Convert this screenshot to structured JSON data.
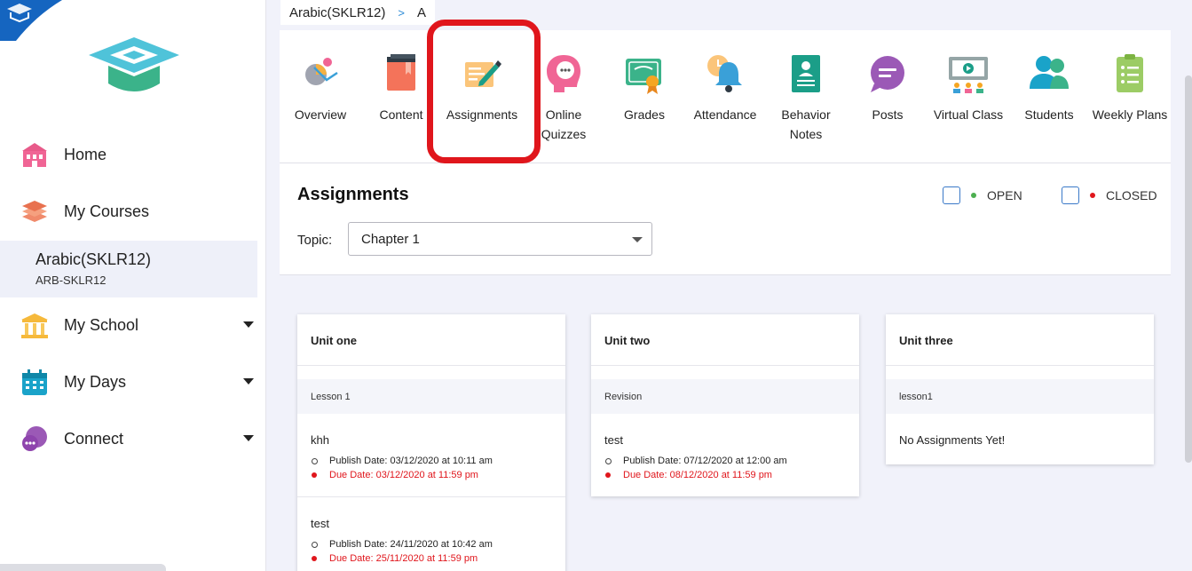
{
  "breadcrumb": {
    "course": "Arabic(SKLR12)",
    "separator": ">",
    "current": "A"
  },
  "sidebar": {
    "items": [
      {
        "label": "Home"
      },
      {
        "label": "My Courses"
      },
      {
        "label": "My School"
      },
      {
        "label": "My Days"
      },
      {
        "label": "Connect"
      }
    ],
    "selected_course": {
      "name": "Arabic(SKLR12)",
      "code": "ARB-SKLR12"
    }
  },
  "tabs": [
    {
      "label": "Overview",
      "icon": "overview-icon"
    },
    {
      "label": "Content",
      "icon": "book-icon"
    },
    {
      "label": "Assignments",
      "icon": "assignment-pen-icon"
    },
    {
      "label": "Online Quizzes",
      "icon": "quiz-head-icon"
    },
    {
      "label": "Grades",
      "icon": "certificate-icon"
    },
    {
      "label": "Attendance",
      "icon": "bell-clock-icon"
    },
    {
      "label": "Behavior Notes",
      "icon": "badge-icon"
    },
    {
      "label": "Posts",
      "icon": "chat-bubble-icon"
    },
    {
      "label": "Virtual Class",
      "icon": "virtual-class-icon"
    },
    {
      "label": "Students",
      "icon": "students-icon"
    },
    {
      "label": "Weekly Plans",
      "icon": "clipboard-icon"
    }
  ],
  "assignments": {
    "title": "Assignments",
    "legend_open": "OPEN",
    "legend_closed": "CLOSED",
    "topic_label": "Topic:",
    "topic_value": "Chapter 1"
  },
  "units": [
    {
      "name": "Unit one",
      "lesson": "Lesson 1",
      "items": [
        {
          "name": "khh",
          "publish": "Publish Date: 03/12/2020 at 10:11 am",
          "due": "Due Date: 03/12/2020 at 11:59 pm"
        },
        {
          "name": "test",
          "publish": "Publish Date: 24/11/2020 at 10:42 am",
          "due": "Due Date: 25/11/2020 at 11:59 pm"
        }
      ]
    },
    {
      "name": "Unit two",
      "lesson": "Revision",
      "items": [
        {
          "name": "test",
          "publish": "Publish Date: 07/12/2020 at 12:00 am",
          "due": "Due Date: 08/12/2020 at 11:59 pm"
        }
      ]
    },
    {
      "name": "Unit three",
      "lesson": "lesson1",
      "empty": "No Assignments Yet!"
    }
  ],
  "colors": {
    "highlight": "#e0161c",
    "open_dot": "#4caf50",
    "closed_dot": "#e0161c",
    "due_text": "#e0161c"
  }
}
